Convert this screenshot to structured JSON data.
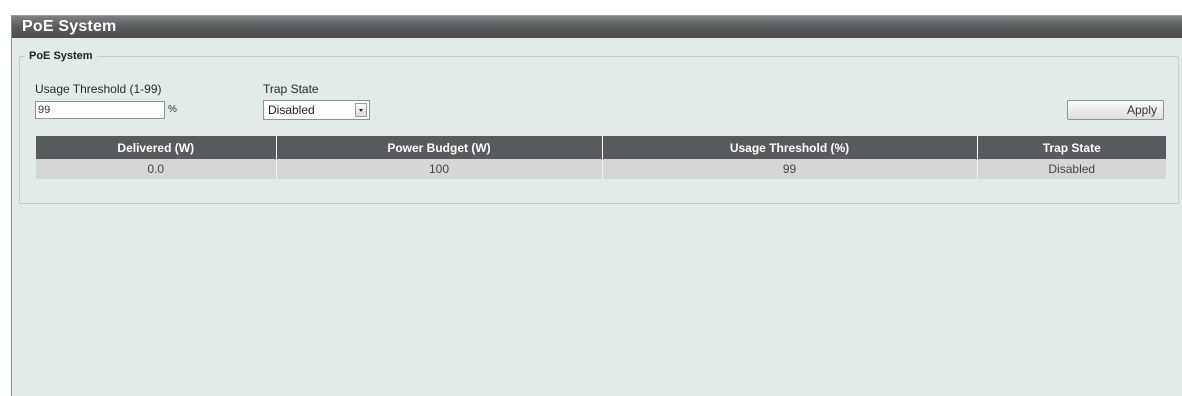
{
  "page": {
    "title": "PoE System"
  },
  "section": {
    "legend": "PoE System",
    "usage_threshold_label": "Usage Threshold (1-99)",
    "usage_threshold_value": "99",
    "percent_unit": "%",
    "trap_state_label": "Trap State",
    "trap_state_selected": "Disabled",
    "apply_label": "Apply"
  },
  "table": {
    "headers": [
      "Delivered (W)",
      "Power Budget (W)",
      "Usage Threshold (%)",
      "Trap State"
    ],
    "rows": [
      [
        "0.0",
        "100",
        "99",
        "Disabled"
      ]
    ]
  },
  "colors": {
    "title_bar": "#4a4d4f",
    "panel_background": "#e1ebea",
    "table_header": "#585b5d",
    "table_row": "#d5d7d7"
  },
  "icons": {
    "select_arrow": "chevron-down-icon"
  }
}
